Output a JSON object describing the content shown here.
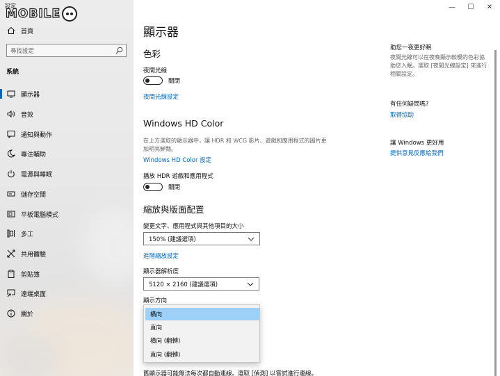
{
  "window": {
    "app_title": "設定",
    "controls": {
      "minimize": "—",
      "maximize": "☐",
      "close": "✕"
    }
  },
  "logo": {
    "text": "MOBILE"
  },
  "sidebar": {
    "home_label": "首頁",
    "search_placeholder": "尋找設定",
    "section_title": "系統",
    "items": [
      {
        "label": "顯示器",
        "icon": "monitor-icon",
        "selected": true
      },
      {
        "label": "音效",
        "icon": "speaker-icon"
      },
      {
        "label": "通知與動作",
        "icon": "notification-icon"
      },
      {
        "label": "專注輔助",
        "icon": "moon-icon"
      },
      {
        "label": "電源與睡眠",
        "icon": "power-icon"
      },
      {
        "label": "儲存空間",
        "icon": "storage-icon"
      },
      {
        "label": "平板電腦模式",
        "icon": "tablet-icon"
      },
      {
        "label": "多工",
        "icon": "multitask-icon"
      },
      {
        "label": "共用體驗",
        "icon": "shared-experience-icon"
      },
      {
        "label": "剪貼簿",
        "icon": "clipboard-icon"
      },
      {
        "label": "遠端桌面",
        "icon": "remote-desktop-icon"
      },
      {
        "label": "關於",
        "icon": "info-icon"
      }
    ]
  },
  "main": {
    "page_title": "顯示器",
    "color": {
      "heading": "色彩",
      "night_light_label": "夜間光線",
      "night_light_state": "關閉",
      "night_light_settings_link": "夜間光線設定"
    },
    "hd_color": {
      "heading": "Windows HD Color",
      "description": "在上方選取的顯示器中，讓 HDR 和 WCG 影片、遊戲和應用程式的圖片更加明亮鮮豔。",
      "settings_link": "Windows HD Color 設定",
      "hdr_label": "播放 HDR 遊戲和應用程式",
      "hdr_state": "關閉"
    },
    "scale_layout": {
      "heading": "縮放與版面配置",
      "scale_label": "變更文字、應用程式與其他項目的大小",
      "scale_value": "150% (建議選項)",
      "advanced_scaling_link": "進階縮放設定",
      "resolution_label": "顯示器解析度",
      "resolution_value": "5120 × 2160 (建議選項)",
      "orientation_label": "顯示方向",
      "orientation_options": [
        "橫向",
        "直向",
        "橫向 (翻轉)",
        "直向 (翻轉)"
      ],
      "orientation_selected_index": 0
    },
    "bottom_text": "舊顯示器可能無法每次都自動連線。選取 [偵測] 以嘗試進行連線。"
  },
  "right_column": {
    "sleep_heading": "助您一夜更好眠",
    "sleep_description": "夜間光線可以在夜晚顯示較暖的色彩協助您入眠。選取 [夜間光線設定] 來進行相關設定。",
    "question_heading": "有任何疑問嗎?",
    "get_help_link": "取得協助",
    "improve_heading": "讓 Windows 更好用",
    "feedback_link": "提供意見反應給我們"
  },
  "colors": {
    "accent": "#0067c0",
    "selection": "#9fd0f7"
  }
}
